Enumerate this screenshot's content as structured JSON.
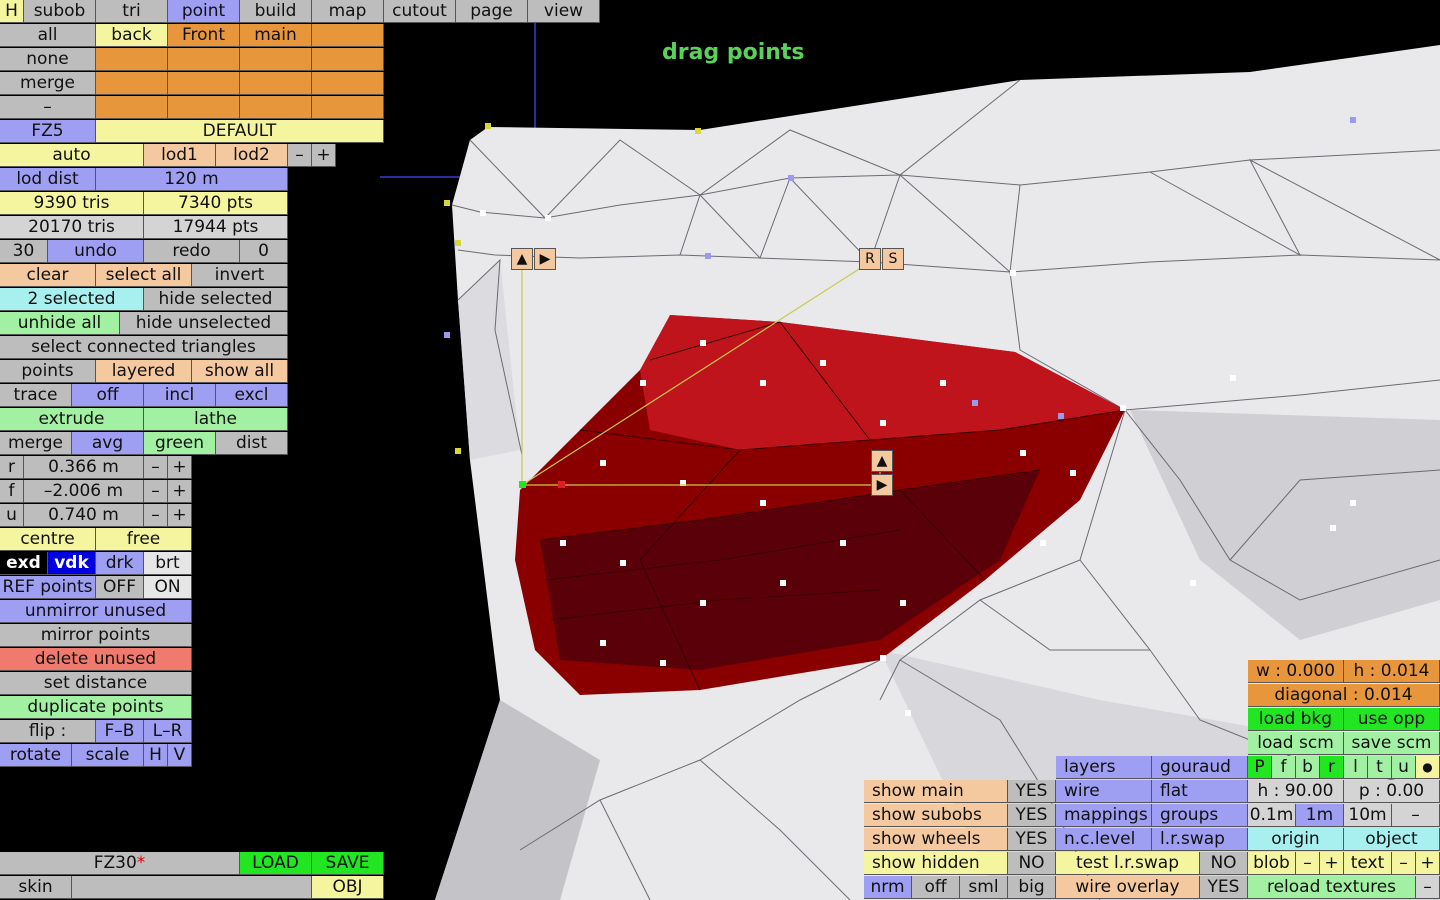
{
  "viewport_title": "drag points",
  "top_tabs": [
    "H",
    "subob",
    "tri",
    "point",
    "build",
    "map",
    "cutout",
    "page",
    "view"
  ],
  "left": {
    "sel_all": "all",
    "sel_none": "none",
    "sel_merge": "merge",
    "sel_dash": "–",
    "view_back": "back",
    "view_front": "Front",
    "view_main": "main",
    "fz": "FZ5",
    "default": "DEFAULT",
    "auto": "auto",
    "lod1": "lod1",
    "lod2": "lod2",
    "minus": "–",
    "plus": "+",
    "lod_dist": "lod dist",
    "lod_value": "120 m",
    "tris1": "9390 tris",
    "pts1": "7340 pts",
    "tris2": "20170 tris",
    "pts2": "17944 pts",
    "undo_count": "30",
    "undo": "undo",
    "redo": "redo",
    "redo_count": "0",
    "clear": "clear",
    "select_all": "select all",
    "invert": "invert",
    "selected": "2 selected",
    "hide_selected": "hide selected",
    "unhide_all": "unhide all",
    "hide_unselected": "hide unselected",
    "select_connected": "select connected triangles",
    "points": "points",
    "layered": "layered",
    "show_all": "show all",
    "trace": "trace",
    "off": "off",
    "incl": "incl",
    "excl": "excl",
    "extrude": "extrude",
    "lathe": "lathe",
    "merge2": "merge",
    "avg": "avg",
    "green": "green",
    "dist": "dist",
    "r_label": "r",
    "r_value": "0.366 m",
    "f_label": "f",
    "f_value": "–2.006 m",
    "u_label": "u",
    "u_value": "0.740 m",
    "centre": "centre",
    "free": "free",
    "exd": "exd",
    "vdk": "vdk",
    "drk": "drk",
    "brt": "brt",
    "ref_points": "REF points",
    "ref_off": "OFF",
    "ref_on": "ON",
    "unmirror_unused": "unmirror unused",
    "mirror_points": "mirror points",
    "delete_unused": "delete unused",
    "set_distance": "set distance",
    "duplicate_points": "duplicate points",
    "flip": "flip :",
    "fb": "F–B",
    "lr": "L–R",
    "rotate": "rotate",
    "scale": "scale",
    "h": "H",
    "v": "V"
  },
  "bottom_left": {
    "file": "FZ30",
    "modified": "*",
    "load": "LOAD",
    "save": "SAVE",
    "skin": "skin",
    "obj": "OBJ"
  },
  "bottom_right": {
    "show_main": "show main",
    "show_main_v": "YES",
    "show_subobs": "show subobs",
    "show_subobs_v": "YES",
    "show_wheels": "show wheels",
    "show_wheels_v": "YES",
    "show_hidden": "show hidden",
    "show_hidden_v": "NO",
    "nrm": "nrm",
    "off": "off",
    "sml": "sml",
    "big": "big",
    "layers": "layers",
    "gouraud": "gouraud",
    "wire": "wire",
    "flat": "flat",
    "mappings": "mappings",
    "groups": "groups",
    "nc_level": "n.c.level",
    "lr_swap": "l.r.swap",
    "test_lr_swap": "test l.r.swap",
    "test_lr_swap_v": "NO",
    "wire_overlay": "wire overlay",
    "wire_overlay_v": "YES",
    "w": "w : 0.000",
    "hh": "h : 0.014",
    "diagonal": "diagonal : 0.014",
    "load_bkg": "load bkg",
    "use_opp": "use opp",
    "load_scm": "load scm",
    "save_scm": "save scm",
    "pf": [
      "P",
      "f",
      "b",
      "r",
      "l",
      "t",
      "u",
      "●"
    ],
    "h90": "h : 90.00",
    "p0": "p : 0.00",
    "s01": "0.1m",
    "s1": "1m",
    "s10": "10m",
    "sminus": "–",
    "origin": "origin",
    "object": "object",
    "blob": "blob",
    "text": "text",
    "minus": "–",
    "plus": "+",
    "reload_textures": "reload textures"
  },
  "handles": {
    "up": "▲",
    "right": "▶",
    "r": "R",
    "s": "S"
  }
}
